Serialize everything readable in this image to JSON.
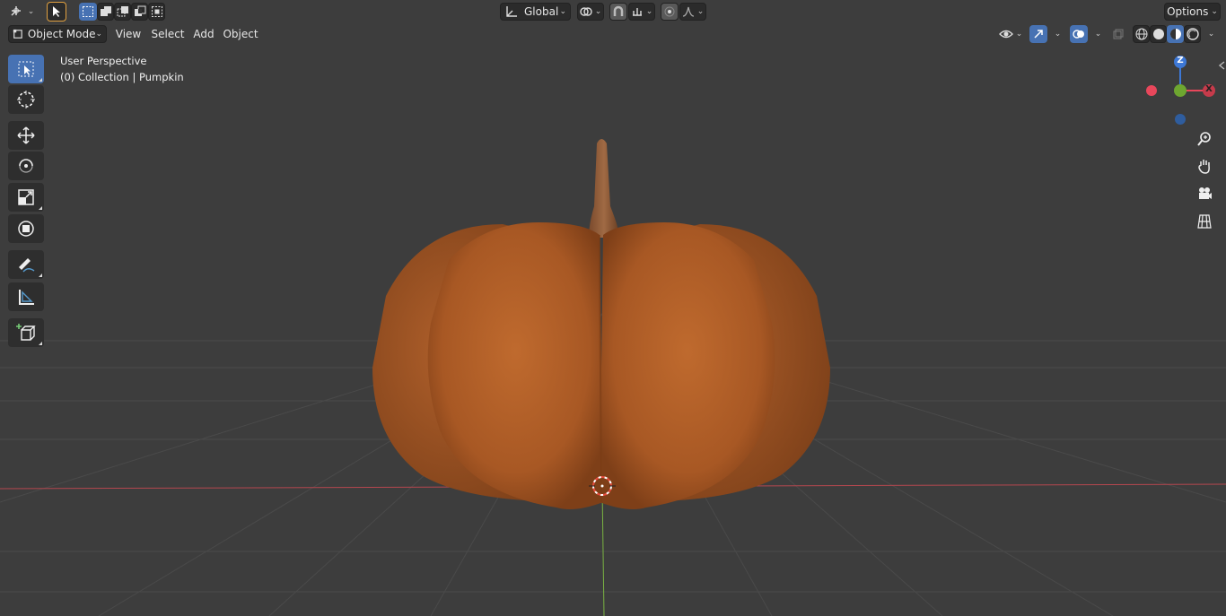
{
  "topbar": {
    "orientation": "Global",
    "options_label": "Options"
  },
  "header": {
    "mode": "Object Mode",
    "menus": [
      "View",
      "Select",
      "Add",
      "Object"
    ]
  },
  "overlay_info": {
    "view_name": "User Perspective",
    "collection_line": "(0) Collection | Pumpkin"
  },
  "gizmo": {
    "z_label": "Z",
    "x_label": "X",
    "x_color": "#e8475b",
    "y_color": "#6ea630",
    "z_color": "#3d78d6"
  },
  "colors": {
    "accent": "#4772b3",
    "background": "#3d3d3d",
    "pumpkin": "#b35f2a",
    "x_axis_line": "#b5474f",
    "y_axis_line": "#7ab342"
  },
  "icons": {
    "toolbar": [
      "select-box-icon",
      "cursor-icon",
      "move-icon",
      "rotate-icon",
      "scale-icon",
      "transform-icon",
      "annotate-icon",
      "measure-icon",
      "add-cube-icon"
    ],
    "navigation": [
      "zoom-icon",
      "hand-pan-icon",
      "camera-icon",
      "grid-ortho-icon"
    ]
  }
}
